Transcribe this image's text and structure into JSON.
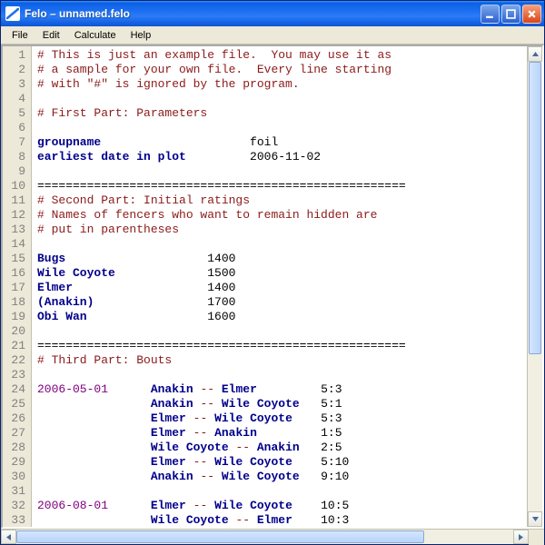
{
  "window": {
    "title": "Felo – unnamed.felo"
  },
  "menu": {
    "file": "File",
    "edit": "Edit",
    "calculate": "Calculate",
    "help": "Help"
  },
  "lines": [
    {
      "tokens": [
        {
          "c": "tok-comment",
          "t": "# This is just an example file.  You may use it as"
        }
      ]
    },
    {
      "tokens": [
        {
          "c": "tok-comment",
          "t": "# a sample for your own file.  Every line starting"
        }
      ]
    },
    {
      "tokens": [
        {
          "c": "tok-comment",
          "t": "# with \"#\" is ignored by the program."
        }
      ]
    },
    {
      "tokens": []
    },
    {
      "tokens": [
        {
          "c": "tok-comment",
          "t": "# First Part: Parameters"
        }
      ]
    },
    {
      "tokens": []
    },
    {
      "tokens": [
        {
          "c": "tok-key",
          "t": "groupname"
        },
        {
          "c": "",
          "t": "                     foil"
        }
      ]
    },
    {
      "tokens": [
        {
          "c": "tok-key",
          "t": "earliest date in plot"
        },
        {
          "c": "",
          "t": "         2006-11-02"
        }
      ]
    },
    {
      "tokens": []
    },
    {
      "tokens": [
        {
          "c": "tok-sep",
          "t": "===================================================="
        }
      ]
    },
    {
      "tokens": [
        {
          "c": "tok-comment",
          "t": "# Second Part: Initial ratings"
        }
      ]
    },
    {
      "tokens": [
        {
          "c": "tok-comment",
          "t": "# Names of fencers who want to remain hidden are"
        }
      ]
    },
    {
      "tokens": [
        {
          "c": "tok-comment",
          "t": "# put in parentheses"
        }
      ]
    },
    {
      "tokens": []
    },
    {
      "tokens": [
        {
          "c": "tok-key",
          "t": "Bugs"
        },
        {
          "c": "",
          "t": "                    1400"
        }
      ]
    },
    {
      "tokens": [
        {
          "c": "tok-key",
          "t": "Wile Coyote"
        },
        {
          "c": "",
          "t": "             1500"
        }
      ]
    },
    {
      "tokens": [
        {
          "c": "tok-key",
          "t": "Elmer"
        },
        {
          "c": "",
          "t": "                   1400"
        }
      ]
    },
    {
      "tokens": [
        {
          "c": "tok-key",
          "t": "(Anakin)"
        },
        {
          "c": "",
          "t": "                1700"
        }
      ]
    },
    {
      "tokens": [
        {
          "c": "tok-key",
          "t": "Obi Wan"
        },
        {
          "c": "",
          "t": "                 1600"
        }
      ]
    },
    {
      "tokens": []
    },
    {
      "tokens": [
        {
          "c": "tok-sep",
          "t": "===================================================="
        }
      ]
    },
    {
      "tokens": [
        {
          "c": "tok-comment",
          "t": "# Third Part: Bouts"
        }
      ]
    },
    {
      "tokens": []
    },
    {
      "tokens": [
        {
          "c": "tok-date",
          "t": "2006-05-01"
        },
        {
          "c": "",
          "t": "      "
        },
        {
          "c": "tok-name",
          "t": "Anakin"
        },
        {
          "c": "tok-dash",
          "t": " -- "
        },
        {
          "c": "tok-name",
          "t": "Elmer"
        },
        {
          "c": "",
          "t": "         5:3"
        }
      ]
    },
    {
      "tokens": [
        {
          "c": "",
          "t": "                "
        },
        {
          "c": "tok-name",
          "t": "Anakin"
        },
        {
          "c": "tok-dash",
          "t": " -- "
        },
        {
          "c": "tok-name",
          "t": "Wile Coyote"
        },
        {
          "c": "",
          "t": "   5:1"
        }
      ]
    },
    {
      "tokens": [
        {
          "c": "",
          "t": "                "
        },
        {
          "c": "tok-name",
          "t": "Elmer"
        },
        {
          "c": "tok-dash",
          "t": " -- "
        },
        {
          "c": "tok-name",
          "t": "Wile Coyote"
        },
        {
          "c": "",
          "t": "    5:3"
        }
      ]
    },
    {
      "tokens": [
        {
          "c": "",
          "t": "                "
        },
        {
          "c": "tok-name",
          "t": "Elmer"
        },
        {
          "c": "tok-dash",
          "t": " -- "
        },
        {
          "c": "tok-name",
          "t": "Anakin"
        },
        {
          "c": "",
          "t": "         1:5"
        }
      ]
    },
    {
      "tokens": [
        {
          "c": "",
          "t": "                "
        },
        {
          "c": "tok-name",
          "t": "Wile Coyote"
        },
        {
          "c": "tok-dash",
          "t": " -- "
        },
        {
          "c": "tok-name",
          "t": "Anakin"
        },
        {
          "c": "",
          "t": "   2:5"
        }
      ]
    },
    {
      "tokens": [
        {
          "c": "",
          "t": "                "
        },
        {
          "c": "tok-name",
          "t": "Elmer"
        },
        {
          "c": "tok-dash",
          "t": " -- "
        },
        {
          "c": "tok-name",
          "t": "Wile Coyote"
        },
        {
          "c": "",
          "t": "    5:10"
        }
      ]
    },
    {
      "tokens": [
        {
          "c": "",
          "t": "                "
        },
        {
          "c": "tok-name",
          "t": "Anakin"
        },
        {
          "c": "tok-dash",
          "t": " -- "
        },
        {
          "c": "tok-name",
          "t": "Wile Coyote"
        },
        {
          "c": "",
          "t": "   9:10"
        }
      ]
    },
    {
      "tokens": []
    },
    {
      "tokens": [
        {
          "c": "tok-date",
          "t": "2006-08-01"
        },
        {
          "c": "",
          "t": "      "
        },
        {
          "c": "tok-name",
          "t": "Elmer"
        },
        {
          "c": "tok-dash",
          "t": " -- "
        },
        {
          "c": "tok-name",
          "t": "Wile Coyote"
        },
        {
          "c": "",
          "t": "    10:5"
        }
      ]
    },
    {
      "tokens": [
        {
          "c": "",
          "t": "                "
        },
        {
          "c": "tok-name",
          "t": "Wile Coyote"
        },
        {
          "c": "tok-dash",
          "t": " -- "
        },
        {
          "c": "tok-name",
          "t": "Elmer"
        },
        {
          "c": "",
          "t": "    10:3"
        }
      ]
    }
  ]
}
